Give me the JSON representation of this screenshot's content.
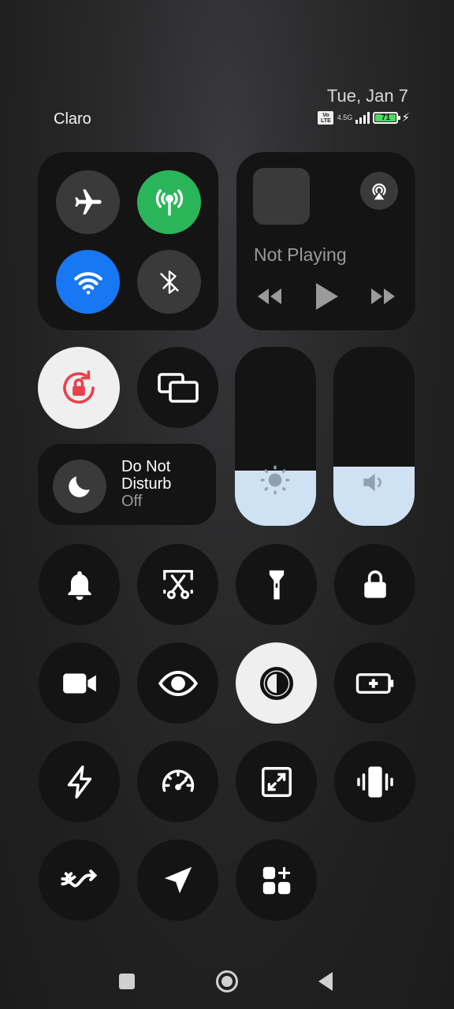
{
  "status_bar": {
    "date": "Tue, Jan 7",
    "carrier": "Claro",
    "volte_label": "Vo LTE",
    "network_label": "4.5G",
    "battery_level": "71",
    "charging": true
  },
  "media": {
    "status": "Not Playing",
    "icons": [
      "cast-icon",
      "rewind-icon",
      "play-icon",
      "fast-forward-icon"
    ]
  },
  "connectivity": {
    "airplane_mode": false,
    "mobile_data": true,
    "wifi": true,
    "bluetooth": false
  },
  "do_not_disturb": {
    "title_line1": "Do Not",
    "title_line2": "Disturb",
    "state": "Off"
  },
  "sliders": {
    "brightness_level": 0.31,
    "volume_level": 0.33
  },
  "toggles": [
    {
      "name": "bell-icon",
      "active": false
    },
    {
      "name": "screenshot-icon",
      "active": false
    },
    {
      "name": "flashlight-icon",
      "active": false
    },
    {
      "name": "lock-icon",
      "active": false
    },
    {
      "name": "video-camera-icon",
      "active": false
    },
    {
      "name": "eye-icon",
      "active": false
    },
    {
      "name": "dark-mode-icon",
      "active": true
    },
    {
      "name": "battery-saver-icon",
      "active": false
    },
    {
      "name": "lightning-icon",
      "active": false
    },
    {
      "name": "speedometer-icon",
      "active": false
    },
    {
      "name": "resize-icon",
      "active": false
    },
    {
      "name": "vibrate-icon",
      "active": false
    },
    {
      "name": "no-sync-icon",
      "active": false
    },
    {
      "name": "location-icon",
      "active": false
    },
    {
      "name": "add-tiles-icon",
      "active": false
    }
  ],
  "colors": {
    "accent_green": "#2bb55a",
    "accent_blue": "#1877f2",
    "active_tile": "#efefef",
    "lock_rotation_red": "#e8414d",
    "slider_fill": "#cfe2f3"
  }
}
